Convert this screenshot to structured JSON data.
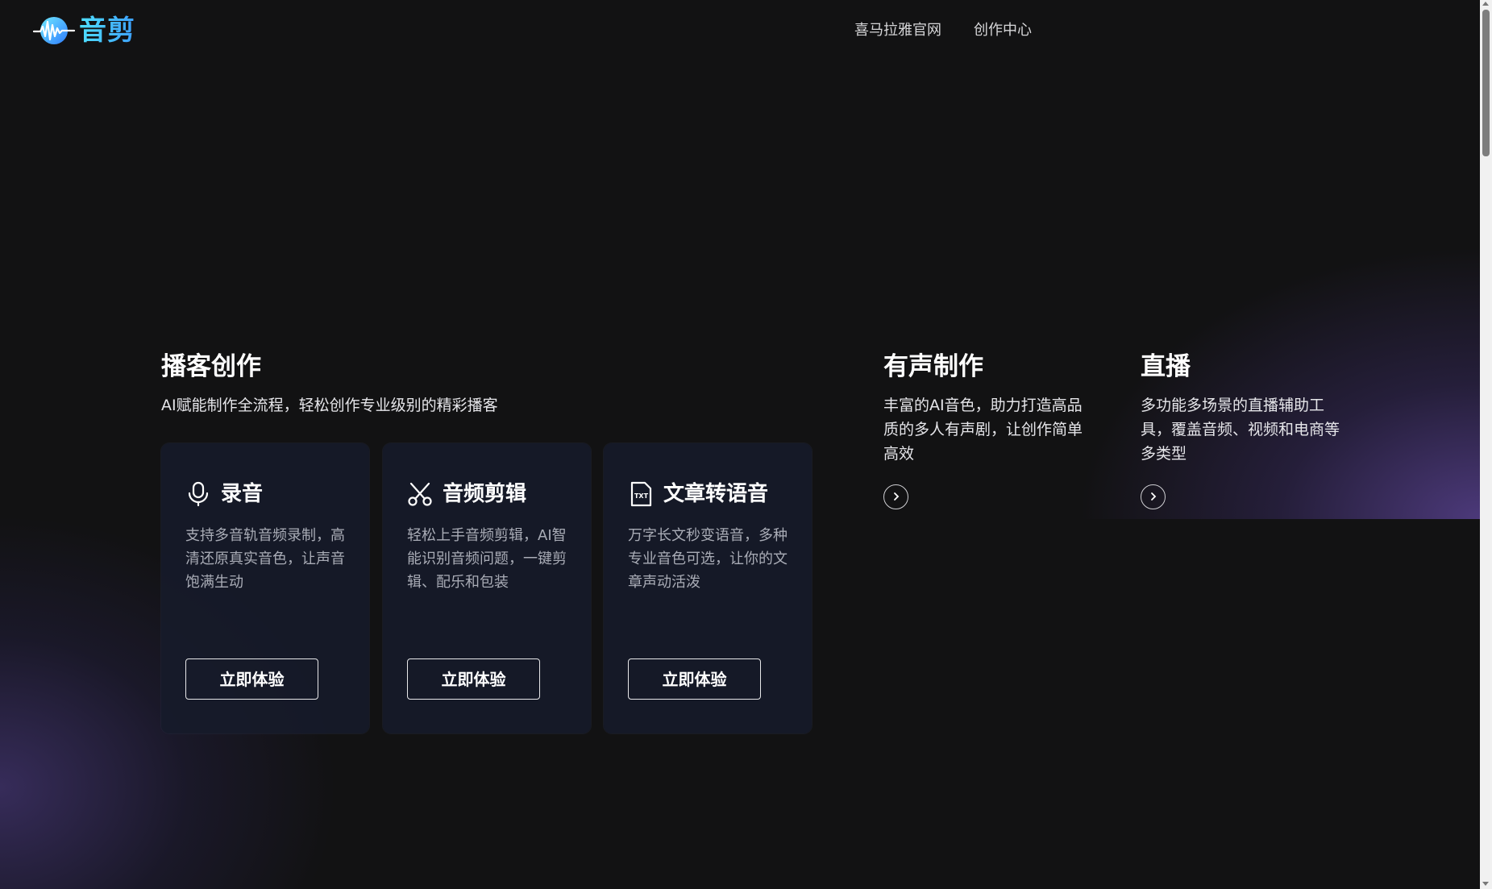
{
  "header": {
    "logo_text": "音剪",
    "nav": [
      "喜马拉雅官网",
      "创作中心"
    ]
  },
  "podcast": {
    "title": "播客创作",
    "subtitle": "AI赋能制作全流程，轻松创作专业级别的精彩播客",
    "cards": [
      {
        "icon": "microphone-icon",
        "title": "录音",
        "desc": "支持多音轨音频录制，高清还原真实音色，让声音饱满生动",
        "button": "立即体验"
      },
      {
        "icon": "scissors-icon",
        "title": "音频剪辑",
        "desc": "轻松上手音频剪辑，AI智能识别音频问题，一键剪辑、配乐和包装",
        "button": "立即体验"
      },
      {
        "icon": "txt-file-icon",
        "title": "文章转语音",
        "desc": "万字长文秒变语音，多种专业音色可选，让你的文章声动活泼",
        "button": "立即体验"
      }
    ]
  },
  "audio_production": {
    "title": "有声制作",
    "desc": "丰富的AI音色，助力打造高品质的多人有声剧，让创作简单高效"
  },
  "live": {
    "title": "直播",
    "desc": "多功能多场景的直播辅助工具，覆盖音频、视频和电商等多类型"
  },
  "colors": {
    "background": "#121213",
    "brand": "#4fd0ff",
    "card_bg": "#161b2a",
    "glow": "#56408c"
  }
}
